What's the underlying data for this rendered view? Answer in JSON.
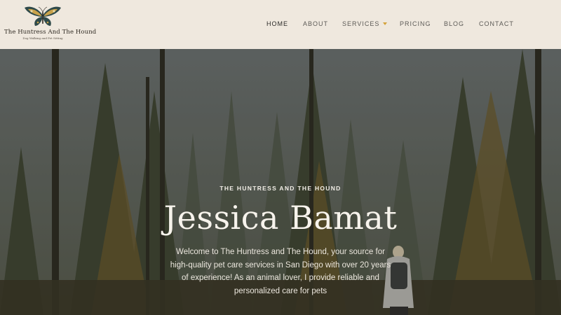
{
  "header": {
    "logo": {
      "title": "The Huntress And The Hound",
      "tagline": "Dog Walking and Pet Sitting",
      "icon": "butterfly-icon"
    },
    "nav": [
      {
        "label": "HOME",
        "active": true
      },
      {
        "label": "ABOUT",
        "active": false
      },
      {
        "label": "SERVICES",
        "active": false,
        "has_dropdown": true
      },
      {
        "label": "PRICING",
        "active": false
      },
      {
        "label": "BLOG",
        "active": false
      },
      {
        "label": "CONTACT",
        "active": false
      }
    ]
  },
  "hero": {
    "kicker": "THE HUNTRESS AND THE HOUND",
    "title": "Jessica Bamat",
    "description": "Welcome to The Huntress and The Hound, your source for high-quality pet care services in San Diego with over 20 years of experience! As an animal lover, I provide reliable and personalized care for pets"
  },
  "colors": {
    "header_bg": "#efe8de",
    "nav_text": "#5c5a56",
    "accent": "#d4a23a",
    "hero_text": "#f7f3ec"
  }
}
